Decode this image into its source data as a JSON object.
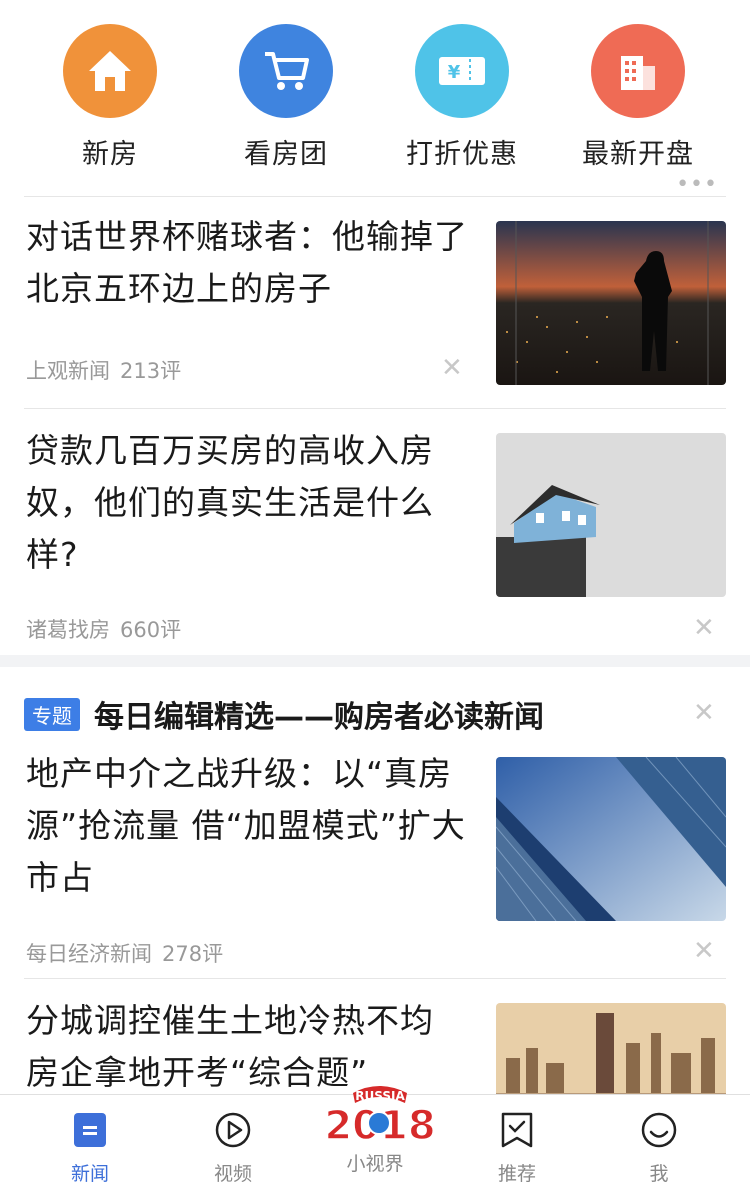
{
  "quick_nav": [
    {
      "label": "新房",
      "icon": "house-icon",
      "color": "#f0923a"
    },
    {
      "label": "看房团",
      "icon": "shopping-cart-icon",
      "color": "#3f84df"
    },
    {
      "label": "打折优惠",
      "icon": "coupon-icon",
      "color": "#4fc3e8"
    },
    {
      "label": "最新开盘",
      "icon": "building-icon",
      "color": "#ef6b55"
    }
  ],
  "articles": [
    {
      "title_lines": [
        "对话世界杯赌球者：他输掉了",
        "北京五环边上的房子"
      ],
      "source": "上观新闻",
      "comments": "213评"
    },
    {
      "title_lines": [
        "贷款几百万买房的高收入房",
        "奴，他们的真实生活是什么",
        "样?"
      ],
      "source": "诸葛找房",
      "comments": "660评"
    }
  ],
  "topic": {
    "badge": "专题",
    "title": "每日编辑精选——购房者必读新闻",
    "articles": [
      {
        "title_lines": [
          "地产中介之战升级：以“真房",
          "源”抢流量 借“加盟模式”扩大",
          "市占"
        ],
        "source": "每日经济新闻",
        "comments": "278评"
      },
      {
        "title_lines": [
          "分城调控催生土地冷热不均",
          "房企拿地开考“综合题”"
        ]
      }
    ]
  },
  "bottom_nav": {
    "items": [
      {
        "label": "新闻",
        "icon": "news-icon",
        "active": true
      },
      {
        "label": "视频",
        "icon": "play-circle-icon"
      },
      {
        "label": "小视界",
        "icon": "russia-2018-logo"
      },
      {
        "label": "推荐",
        "icon": "bookmark-check-icon"
      },
      {
        "label": "我",
        "icon": "smiley-icon"
      }
    ],
    "logo": {
      "top_text": "RUSSIA",
      "year": "2018"
    }
  },
  "colors": {
    "accent": "#3d7ee6",
    "active_nav": "#3d6fd9"
  }
}
